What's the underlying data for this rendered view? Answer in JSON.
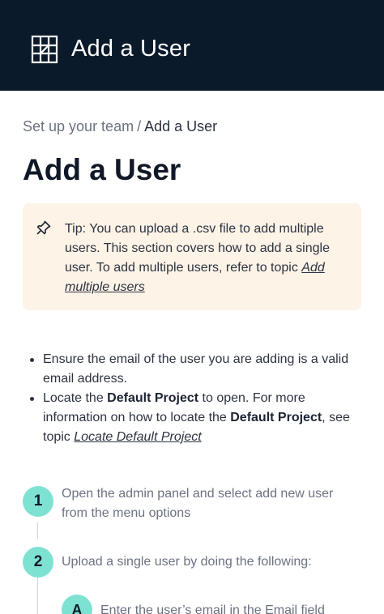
{
  "header": {
    "app_title": "Add a User",
    "logo_icon": "grid-logo-icon",
    "background": "#0b1a2a"
  },
  "breadcrumb": {
    "parent": "Set up your team",
    "separator": "/",
    "current": "Add a User"
  },
  "page_title": "Add a User",
  "tip": {
    "icon": "pin-icon",
    "text": "Tip: You can upload a .csv file to add multiple users. This section covers how to add a single user. To add multiple users, refer to topic ",
    "link": "Add multiple users",
    "background": "#fdf3e7"
  },
  "prerequisites": [
    {
      "text_before": "Ensure the email of the user you are adding is a valid email address."
    },
    {
      "text_before": "Locate the ",
      "bold1": "Default Project",
      "text_middle": " to open. For more information on how to locate the ",
      "bold2": "Default Project",
      "text_after": ", see topic ",
      "link": "Locate Default Project"
    }
  ],
  "steps": [
    {
      "number": "1",
      "text": "Open the admin panel and select add new user from the menu options"
    },
    {
      "number": "2",
      "text": "Upload a single user by doing the following:"
    }
  ],
  "substeps": [
    {
      "letter": "A",
      "text": "Enter the user’s email in the Email field"
    }
  ],
  "accent_color": "#7ee2d3"
}
